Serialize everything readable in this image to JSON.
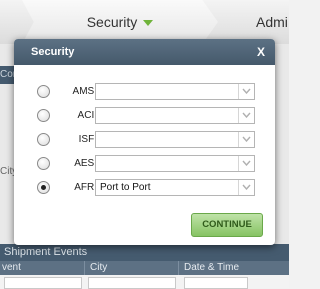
{
  "background": {
    "tabs": {
      "security": "Security",
      "admin": "Admi"
    },
    "left_strip": "Cons",
    "left_city": "City",
    "events_title": "Shipment Events",
    "table_headers": [
      "vent",
      "City",
      "Date & Time"
    ]
  },
  "modal": {
    "title": "Security",
    "close": "X",
    "rows": [
      {
        "label": "AMS:",
        "value": "",
        "checked": false
      },
      {
        "label": "ACI:",
        "value": "",
        "checked": false
      },
      {
        "label": "ISF:",
        "value": "",
        "checked": false
      },
      {
        "label": "AES:",
        "value": "",
        "checked": false
      },
      {
        "label": "AFR:",
        "value": "Port to Port",
        "checked": true
      }
    ],
    "continue_label": "CONTINUE"
  },
  "colors": {
    "header": "#4f6477",
    "accent_green": "#86c363",
    "caret_green": "#6fb33a"
  }
}
